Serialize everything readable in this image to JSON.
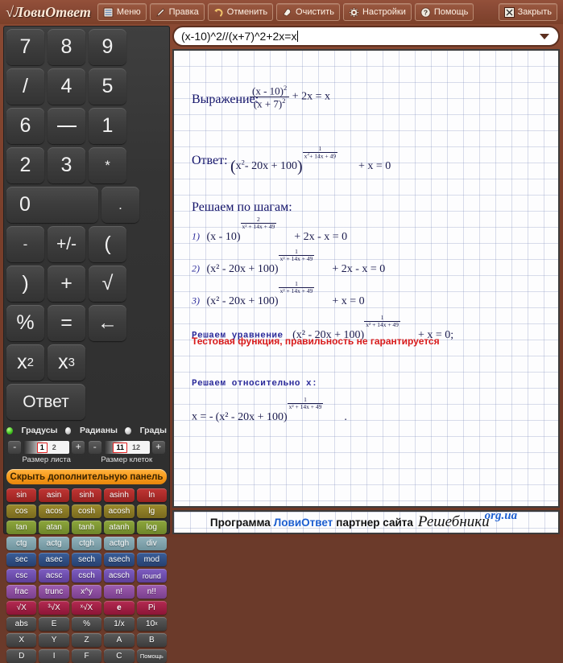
{
  "app": {
    "logo": "ЛовиОтвет",
    "toolbar": [
      {
        "label": "Меню",
        "icon": "menu-icon"
      },
      {
        "label": "Правка",
        "icon": "pencil-icon"
      },
      {
        "label": "Отменить",
        "icon": "undo-icon"
      },
      {
        "label": "Очистить",
        "icon": "eraser-icon"
      },
      {
        "label": "Настройки",
        "icon": "gear-icon"
      },
      {
        "label": "Помощь",
        "icon": "help-icon"
      }
    ],
    "close_label": "Закрыть",
    "close_icon": "close-icon"
  },
  "keypad": {
    "keys": [
      {
        "label": "7"
      },
      {
        "label": "8"
      },
      {
        "label": "9"
      },
      {
        "label": "/"
      },
      {
        "label": "4"
      },
      {
        "label": "5"
      },
      {
        "label": "6"
      },
      {
        "label": "—"
      },
      {
        "label": "1"
      },
      {
        "label": "2"
      },
      {
        "label": "3"
      },
      {
        "label": "*"
      },
      {
        "label": "0"
      },
      {
        "label": "."
      },
      {
        "label": "-"
      },
      {
        "label": "+/-"
      },
      {
        "label": "("
      },
      {
        "label": ")"
      },
      {
        "label": "+"
      },
      {
        "label": "√"
      },
      {
        "label": "%"
      },
      {
        "label": "="
      },
      {
        "label": "←"
      },
      {
        "label": "x2"
      },
      {
        "label": "x3"
      },
      {
        "label": "Ответ"
      }
    ]
  },
  "angle_modes": {
    "options": [
      {
        "label": "Градусы",
        "selected": true
      },
      {
        "label": "Радианы",
        "selected": false
      },
      {
        "label": "Грады",
        "selected": false
      }
    ]
  },
  "spinners": [
    {
      "caption": "Размер листа",
      "value": "1",
      "max": "2",
      "minus": "-",
      "plus": "+"
    },
    {
      "caption": "Размер клеток",
      "value": "11",
      "max": "12",
      "minus": "-",
      "plus": "+"
    }
  ],
  "hide_panel_button": "Скрыть дополнительную панель",
  "function_rows": [
    {
      "color": "#a82a28",
      "keys": [
        "sin",
        "asin",
        "sinh",
        "asinh",
        "ln"
      ]
    },
    {
      "color": "#8a7a26",
      "keys": [
        "cos",
        "acos",
        "cosh",
        "acosh",
        "lg"
      ]
    },
    {
      "color": "#7d9333",
      "keys": [
        "tan",
        "atan",
        "tanh",
        "atanh",
        "log"
      ]
    },
    {
      "color": "#7fa2ab",
      "keys": [
        "ctg",
        "actg",
        "ctgh",
        "actgh",
        "div"
      ]
    },
    {
      "color": "#2f4f84",
      "keys": [
        "sec",
        "asec",
        "sech",
        "asech",
        "mod"
      ]
    },
    {
      "color": "#6d4fa8",
      "keys": [
        "csc",
        "acsc",
        "csch",
        "acsch",
        "round"
      ]
    },
    {
      "color": "#8a4f9e",
      "keys": [
        "frac",
        "trunc",
        "x^y",
        "n!",
        "n!!"
      ]
    },
    {
      "color": "#9e1f45",
      "keys": [
        "√X",
        "³√X",
        "ˣ√X",
        "e",
        "Pi"
      ]
    },
    {
      "color": "#4a4a4a",
      "keys": [
        "abs",
        "E",
        "%",
        "1/x",
        "10x"
      ]
    },
    {
      "color": "#4a4a4a",
      "keys": [
        "X",
        "Y",
        "Z",
        "A",
        "B"
      ]
    },
    {
      "color": "#4a4a4a",
      "keys": [
        "D",
        "I",
        "F",
        "C",
        "Помощь"
      ]
    }
  ],
  "input": {
    "value": "(x-10)^2//(x+7)^2+2x=x",
    "placeholder": "",
    "dropdown_icon": "chevron-down-icon"
  },
  "document": {
    "label_expression": "Выражение:",
    "label_answer": "Ответ:",
    "label_steps": "Решаем по шагам:",
    "label_solve_equation": "Решаем уравнение",
    "warning": "Тестовая функция, правильность не гарантируется",
    "label_solve_for_x": "Решаем относительно x:",
    "expression": {
      "num": "(x - 10)",
      "num_exp": "2",
      "den": "(x + 7)",
      "den_exp": "2",
      "tail": "+ 2x = x"
    },
    "answer": {
      "base": "x",
      "base_exp": "2",
      "base_rest": "- 20x + 100",
      "exp_num": "1",
      "exp_den_a": "x",
      "exp_den_sup": "2",
      "exp_den_rest": "+ 14x + 49",
      "tail": "+ x = 0"
    },
    "steps": [
      {
        "index": "1)",
        "base": "(x - 10)",
        "exp_num": "2",
        "exp_den": "x² + 14x + 49",
        "tail": "+ 2x - x = 0"
      },
      {
        "index": "2)",
        "base": "(x² - 20x + 100)",
        "exp_num": "1",
        "exp_den": "x² + 14x + 49",
        "tail": "+ 2x - x = 0"
      },
      {
        "index": "3)",
        "base": "(x² - 20x + 100)",
        "exp_num": "1",
        "exp_den": "x² + 14x + 49",
        "tail": "+ x = 0"
      }
    ],
    "solve_equation": {
      "base": "(x² - 20x + 100)",
      "exp_num": "1",
      "exp_den": "x² + 14x + 49",
      "tail": "+ x = 0;"
    },
    "final": {
      "lhs": "x = -",
      "base": "(x² - 20x + 100)",
      "exp_num": "1",
      "exp_den": "x² + 14x + 49",
      "tail": "."
    }
  },
  "banner": {
    "prefix": "Программа",
    "brand": "ЛовиОтвет",
    "middle": "партнер сайта",
    "site": "Решебники",
    "tld": "org.ua"
  }
}
